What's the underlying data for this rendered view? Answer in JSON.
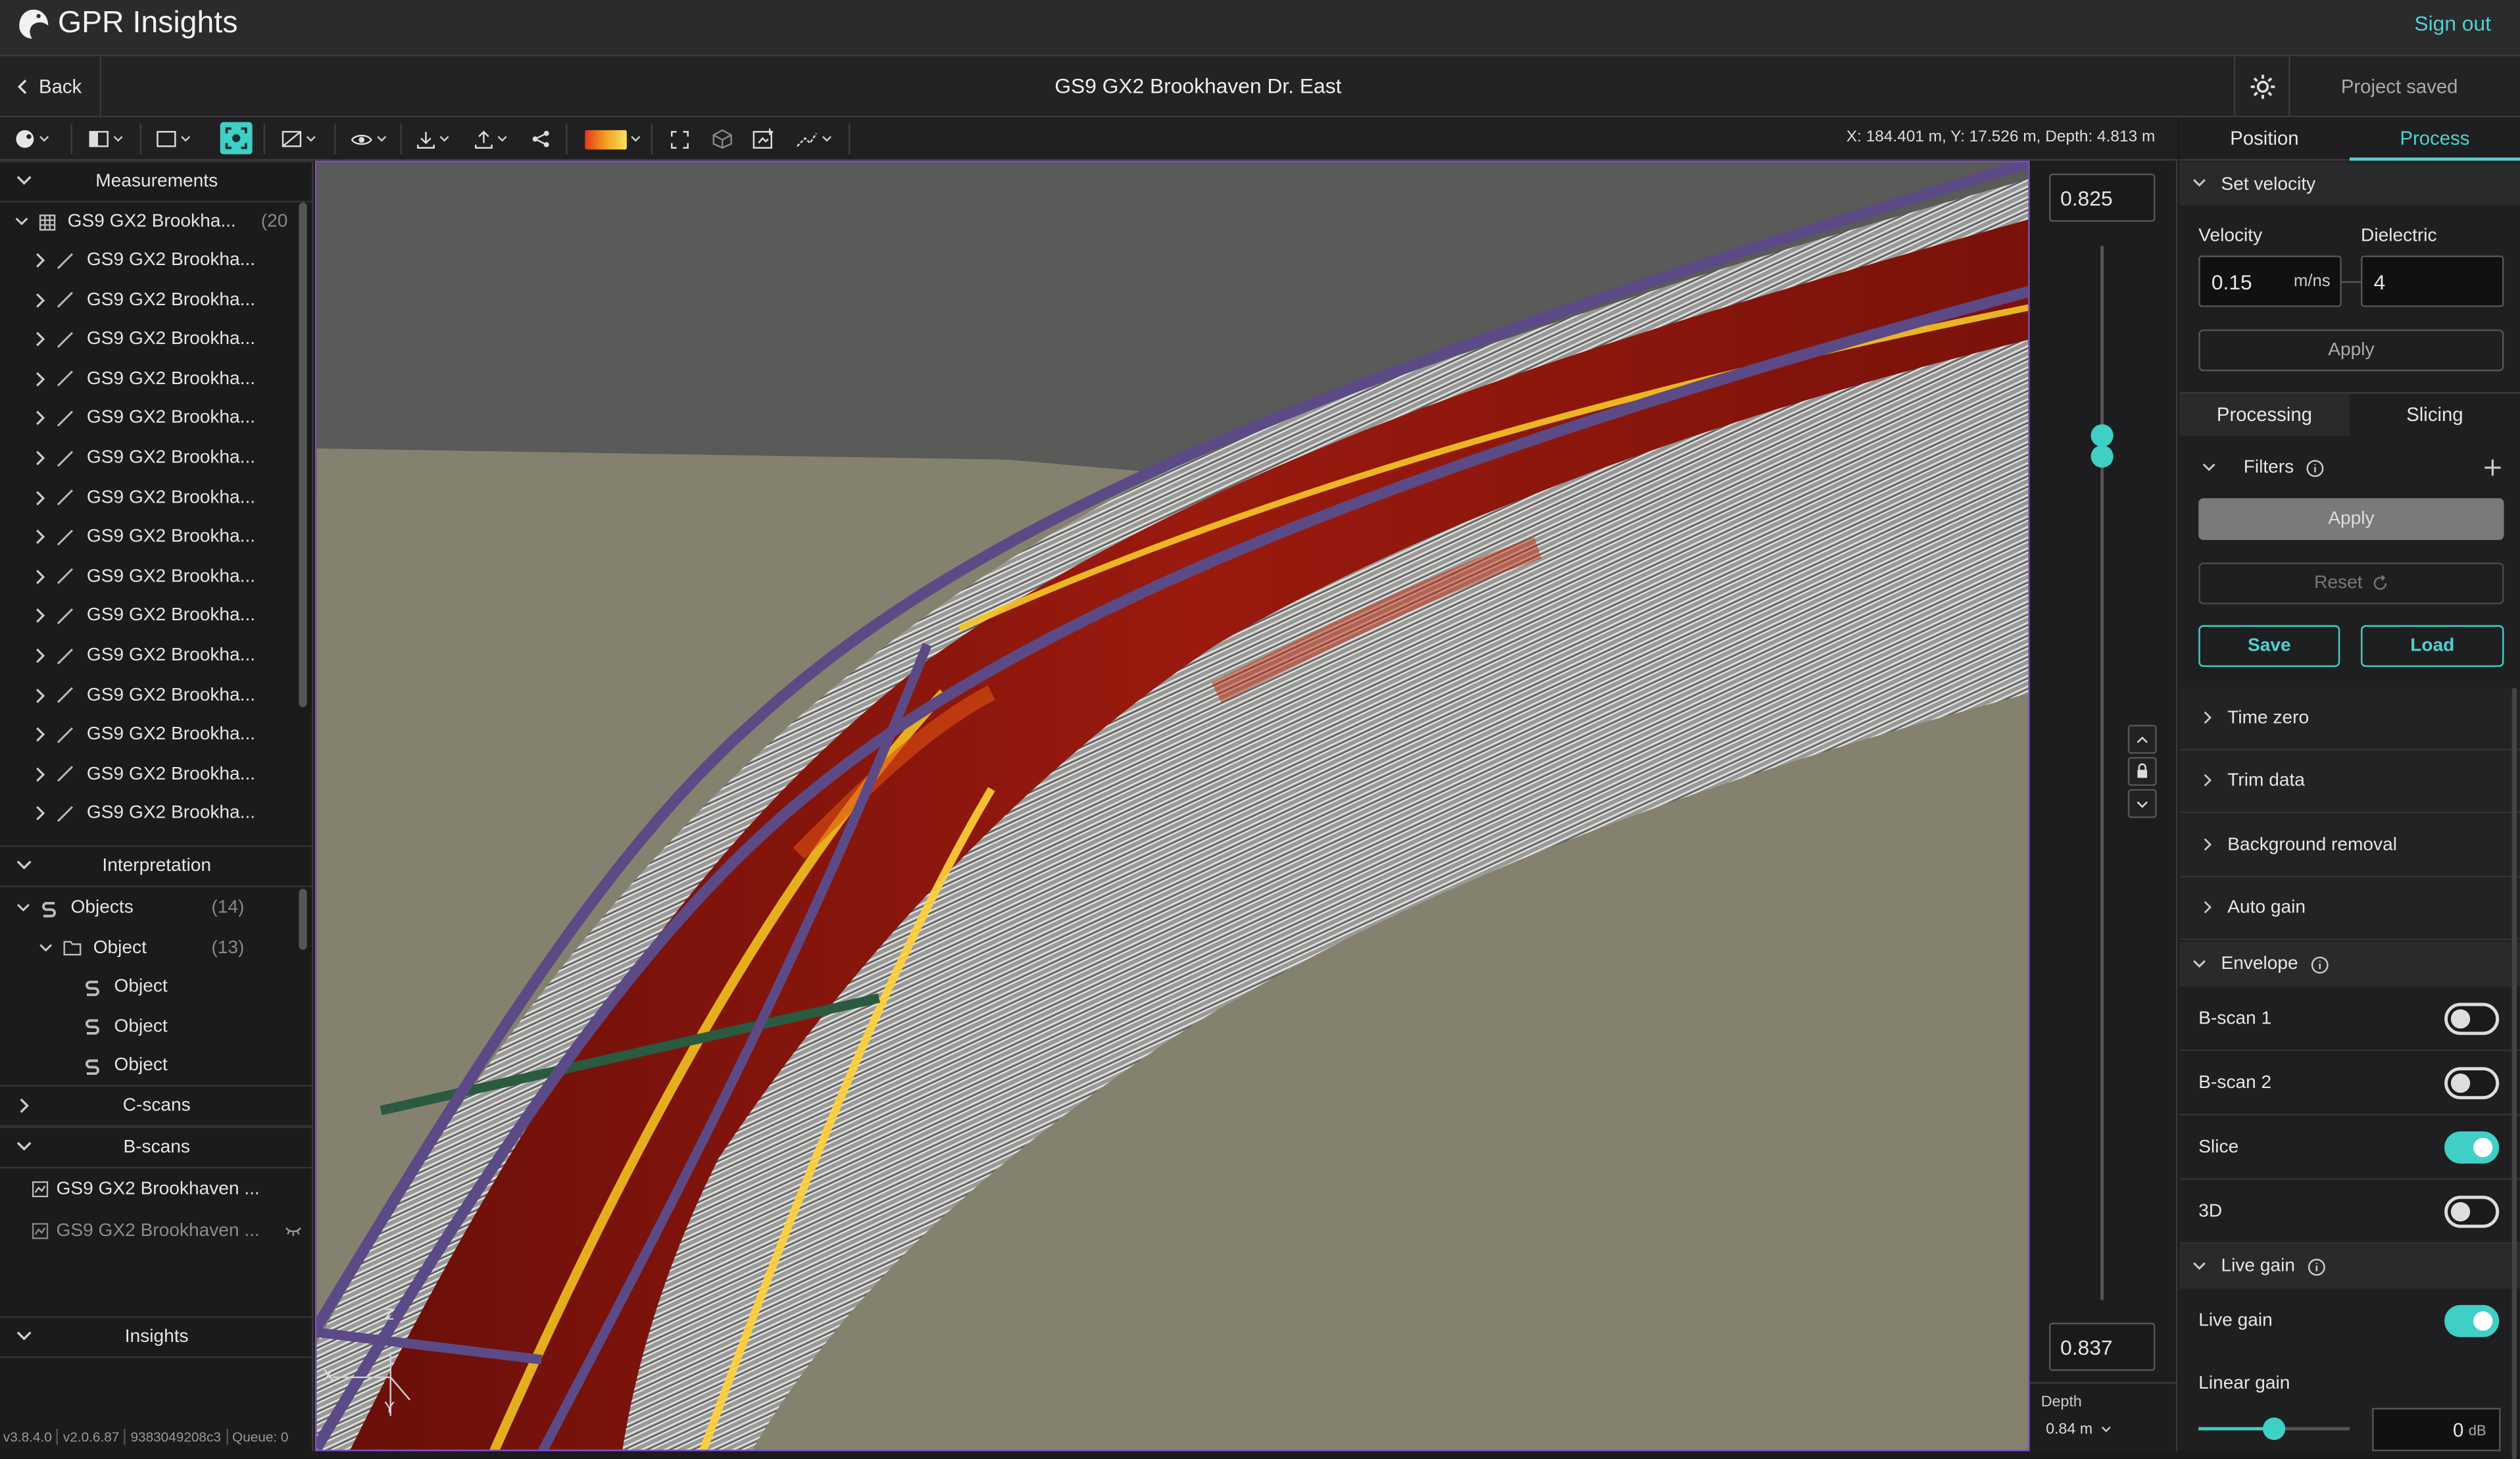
{
  "app": {
    "name": "GPR Insights",
    "sign_out": "Sign out"
  },
  "header": {
    "back": "Back",
    "project_title": "GS9 GX2 Brookhaven Dr. East",
    "status": "Project saved"
  },
  "toolbar": {
    "coords": "X: 184.401 m, Y: 17.526 m, Depth: 4.813 m",
    "colormap_colors": [
      "#e03a1a",
      "#f5a020",
      "#f8e060"
    ]
  },
  "left": {
    "measurements": {
      "header": "Measurements",
      "group": {
        "label": "GS9 GX2 Brookha...",
        "count": "(20"
      },
      "items": [
        "GS9 GX2 Brookha...",
        "GS9 GX2 Brookha...",
        "GS9 GX2 Brookha...",
        "GS9 GX2 Brookha...",
        "GS9 GX2 Brookha...",
        "GS9 GX2 Brookha...",
        "GS9 GX2 Brookha...",
        "GS9 GX2 Brookha...",
        "GS9 GX2 Brookha...",
        "GS9 GX2 Brookha...",
        "GS9 GX2 Brookha...",
        "GS9 GX2 Brookha...",
        "GS9 GX2 Brookha...",
        "GS9 GX2 Brookha...",
        "GS9 GX2 Brookha..."
      ]
    },
    "interpretation": {
      "header": "Interpretation",
      "objects": {
        "label": "Objects",
        "count": "(14)"
      },
      "object_folder": {
        "label": "Object",
        "count": "(13)"
      },
      "object_items": [
        "Object",
        "Object",
        "Object"
      ]
    },
    "cscans": {
      "header": "C-scans"
    },
    "bscans": {
      "header": "B-scans",
      "items": [
        "GS9 GX2 Brookhaven ...",
        "GS9 GX2 Brookhaven ..."
      ]
    },
    "insights": {
      "header": "Insights"
    },
    "version": [
      "v3.8.4.0",
      "v2.0.6.87",
      "9383049208c3",
      "Queue: 0"
    ]
  },
  "viewport": {
    "axis_labels": [
      "Z",
      "X",
      "Y"
    ]
  },
  "depth": {
    "top_value": "0.825",
    "bottom_value": "0.837",
    "slider_upper": 0.82,
    "slider_lower": 0.8,
    "label": "Depth",
    "select_value": "0.84 m"
  },
  "right": {
    "tabs": [
      "Position",
      "Process"
    ],
    "active_tab": "Process",
    "set_velocity": {
      "title": "Set velocity",
      "velocity_label": "Velocity",
      "velocity_value": "0.15",
      "velocity_unit": "m/ns",
      "dielectric_label": "Dielectric",
      "dielectric_value": "4",
      "apply": "Apply"
    },
    "subtabs": [
      "Processing",
      "Slicing"
    ],
    "filters": {
      "title": "Filters",
      "apply": "Apply",
      "reset": "Reset",
      "save": "Save",
      "load": "Load"
    },
    "accordions": [
      "Time zero",
      "Trim data",
      "Background removal",
      "Auto gain"
    ],
    "envelope": {
      "title": "Envelope",
      "rows": [
        {
          "label": "B-scan 1",
          "on": false
        },
        {
          "label": "B-scan 2",
          "on": false
        },
        {
          "label": "Slice",
          "on": true
        },
        {
          "label": "3D",
          "on": false
        }
      ]
    },
    "live_gain": {
      "title": "Live gain",
      "toggle_label": "Live gain",
      "toggle_on": true,
      "linear_gain_label": "Linear gain",
      "linear_gain_value": "0",
      "linear_gain_unit": "dB",
      "linear_gain_fraction": 0.5
    }
  },
  "colors": {
    "accent": "#4fd1d1",
    "toggle_on": "#3fcfc6",
    "viewport_border": "#7b52c4",
    "pipe": "#5b4a86"
  }
}
